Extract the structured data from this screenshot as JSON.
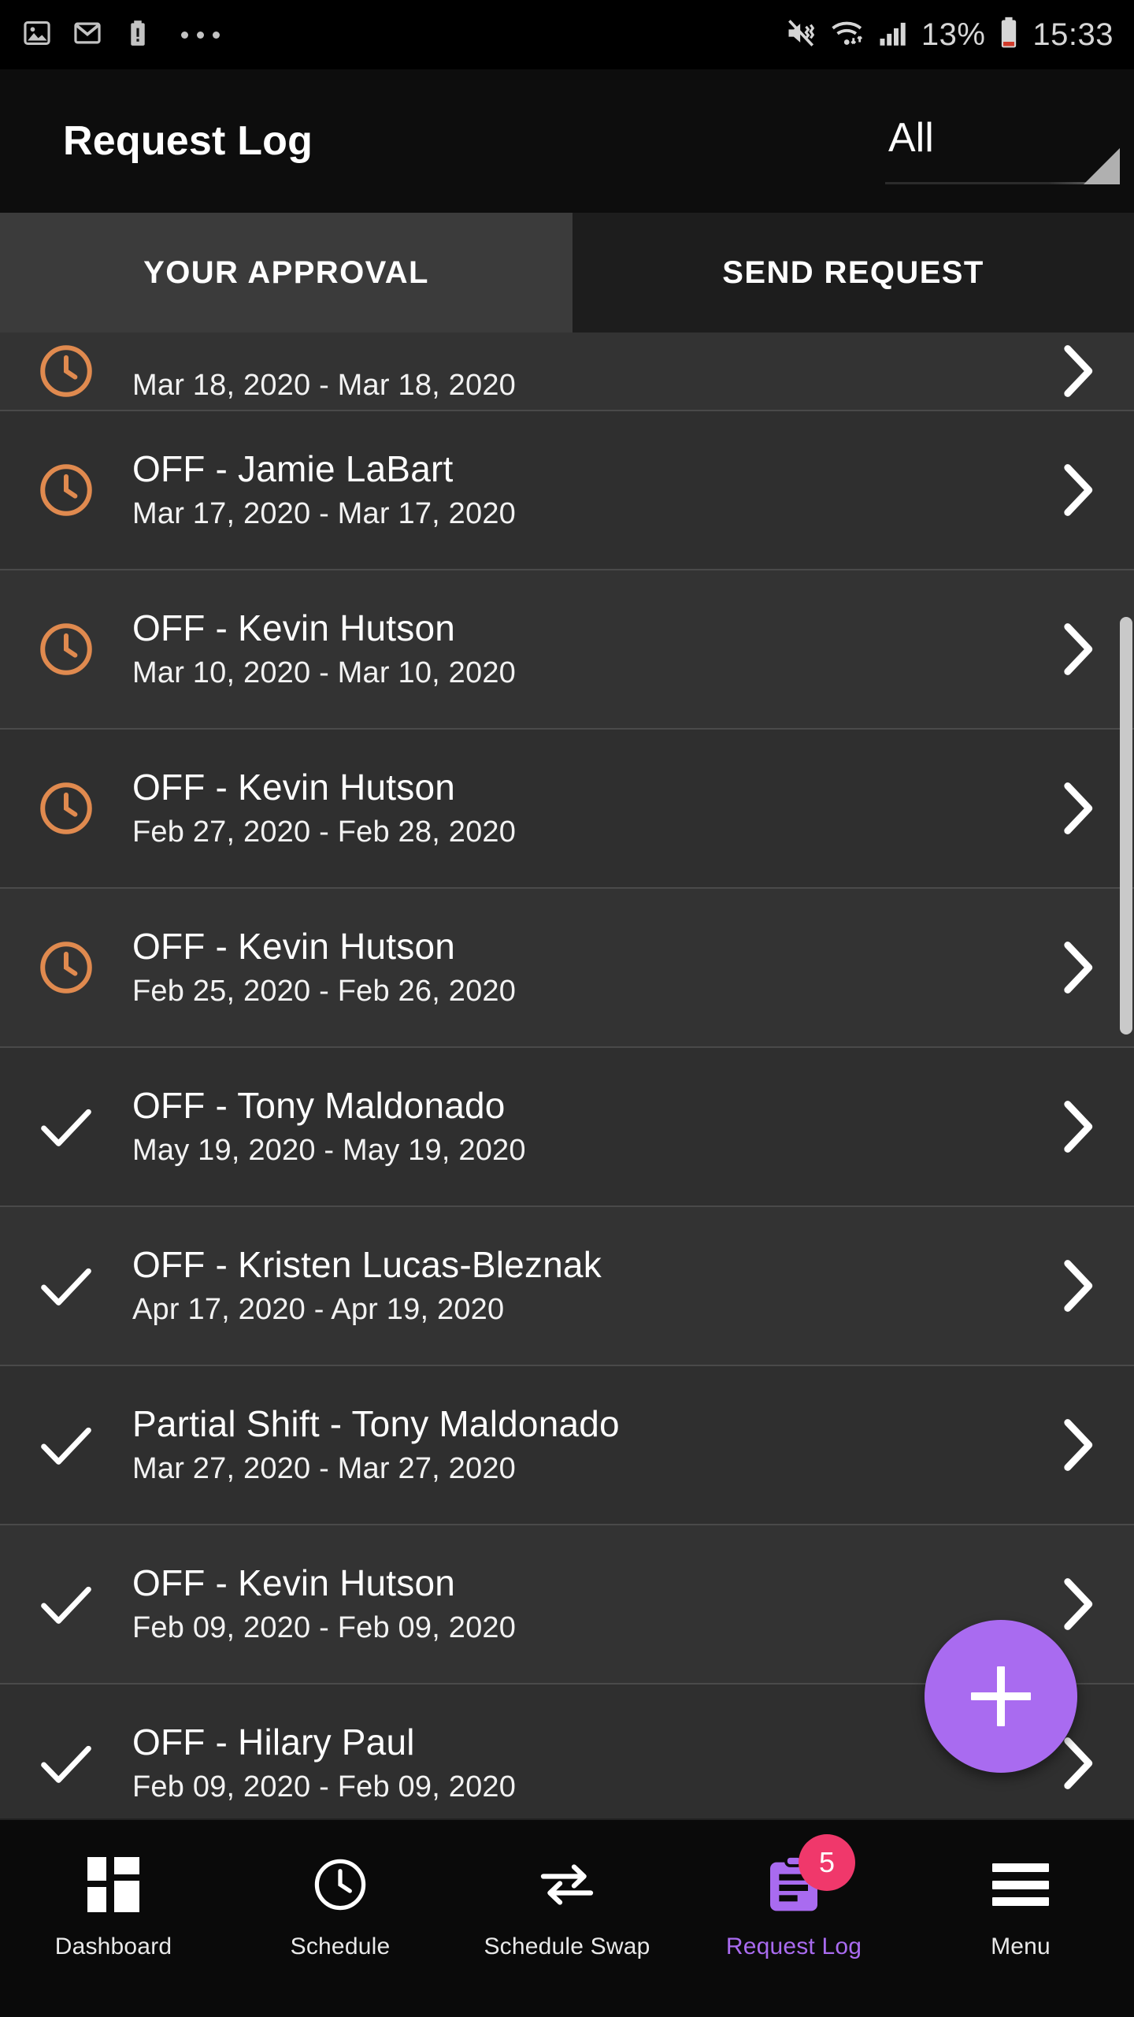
{
  "statusbar": {
    "left_icons": [
      "image-icon",
      "gmail-icon",
      "battery-alert-icon",
      "overflow-dots-icon"
    ],
    "battery_percent": "13%",
    "time": "15:33",
    "right_icons": [
      "mute-vibrate-icon",
      "wifi-icon",
      "signal-icon",
      "battery-icon"
    ]
  },
  "appbar": {
    "title": "Request Log",
    "filter_value": "All"
  },
  "tabs": [
    {
      "label": "YOUR APPROVAL",
      "active": true
    },
    {
      "label": "SEND REQUEST",
      "active": false
    }
  ],
  "list": {
    "rows": [
      {
        "title": "",
        "dates": "Mar 18, 2020 - Mar 18, 2020",
        "status": "pending",
        "clipped": true
      },
      {
        "title": "OFF - Jamie LaBart",
        "dates": "Mar 17, 2020 - Mar 17, 2020",
        "status": "pending"
      },
      {
        "title": "OFF - Kevin Hutson",
        "dates": "Mar 10, 2020 - Mar 10, 2020",
        "status": "pending"
      },
      {
        "title": "OFF - Kevin Hutson",
        "dates": "Feb 27, 2020 - Feb 28, 2020",
        "status": "pending"
      },
      {
        "title": "OFF - Kevin Hutson",
        "dates": "Feb 25, 2020 - Feb 26, 2020",
        "status": "pending"
      },
      {
        "title": "OFF - Tony Maldonado",
        "dates": "May 19, 2020 - May 19, 2020",
        "status": "approved"
      },
      {
        "title": "OFF - Kristen Lucas-Bleznak",
        "dates": "Apr 17, 2020 - Apr 19, 2020",
        "status": "approved"
      },
      {
        "title": "Partial Shift - Tony Maldonado",
        "dates": "Mar 27, 2020 - Mar 27, 2020",
        "status": "approved"
      },
      {
        "title": "OFF - Kevin Hutson",
        "dates": "Feb 09, 2020 - Feb 09, 2020",
        "status": "approved"
      },
      {
        "title": "OFF - Hilary Paul",
        "dates": "Feb 09, 2020 - Feb 09, 2020",
        "status": "approved"
      }
    ]
  },
  "fab": {
    "icon": "plus-icon"
  },
  "bottomnav": {
    "items": [
      {
        "label": "Dashboard",
        "icon": "dashboard-grid-icon",
        "active": false
      },
      {
        "label": "Schedule",
        "icon": "clock-icon",
        "active": false
      },
      {
        "label": "Schedule Swap",
        "icon": "swap-arrows-icon",
        "active": false
      },
      {
        "label": "Request Log",
        "icon": "request-log-icon",
        "active": true,
        "badge": "5"
      },
      {
        "label": "Menu",
        "icon": "hamburger-icon",
        "active": false
      }
    ]
  },
  "colors": {
    "accent_purple": "#a96bf0",
    "pending_orange": "#e08a4f",
    "badge_pink": "#f0386b",
    "active_tab_bg": "#3b3b3b",
    "row_bg": "#333333"
  }
}
